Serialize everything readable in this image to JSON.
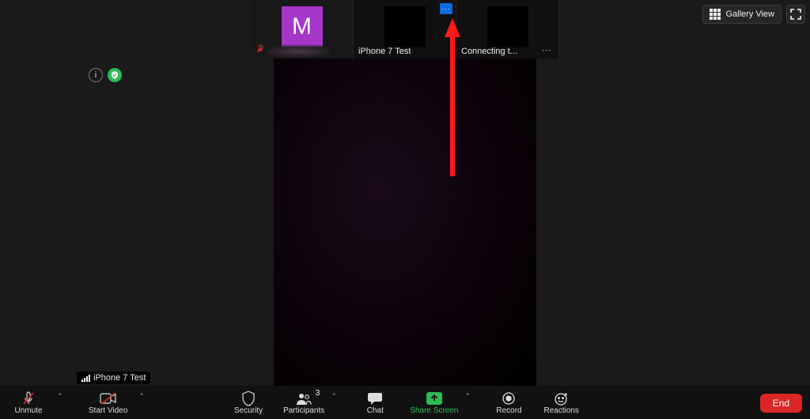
{
  "view": {
    "gallery_label": "Gallery View"
  },
  "thumbs": [
    {
      "avatar_letter": "M",
      "muted": true
    },
    {
      "label": "iPhone 7 Test"
    },
    {
      "label": "Connecting t...",
      "has_more": true
    }
  ],
  "toolbar": {
    "unmute": "Unmute",
    "start_video": "Start Video",
    "security": "Security",
    "participants": "Participants",
    "participants_count": "3",
    "chat": "Chat",
    "share": "Share Screen",
    "record": "Record",
    "reactions": "Reactions",
    "end": "End"
  },
  "active_speaker_label": "iPhone 7 Test",
  "colors": {
    "avatar": "#a436c9",
    "share_green": "#2dbb54",
    "end_red": "#dc2626",
    "accent_blue": "#0e6bdd"
  }
}
